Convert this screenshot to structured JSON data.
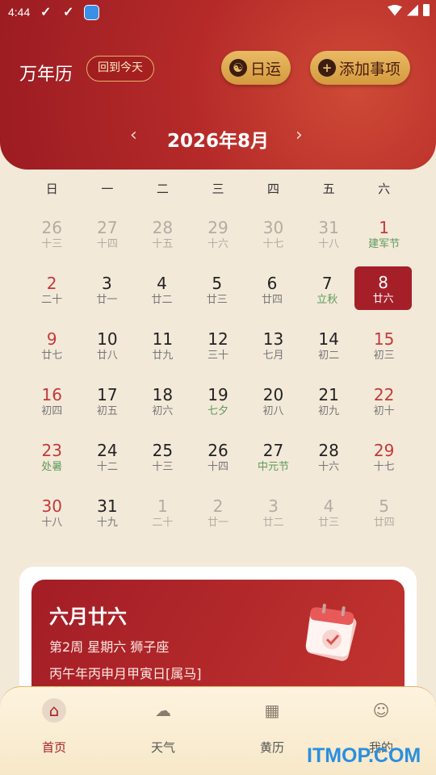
{
  "status": {
    "time": "4:44"
  },
  "header": {
    "title": "万年历",
    "today_label": "回到今天",
    "fortune_label": "日运",
    "add_label": "添加事项",
    "month": "2026年8月",
    "prev": "‹",
    "next": "›"
  },
  "weekdays": [
    "日",
    "一",
    "二",
    "三",
    "四",
    "五",
    "六"
  ],
  "weeks": [
    [
      {
        "d": "26",
        "l": "十三"
      },
      {
        "d": "27",
        "l": "十四"
      },
      {
        "d": "28",
        "l": "十五"
      },
      {
        "d": "29",
        "l": "十六"
      },
      {
        "d": "30",
        "l": "十七"
      },
      {
        "d": "31",
        "l": "十八"
      },
      {
        "d": "1",
        "l": "建军节"
      }
    ],
    [
      {
        "d": "2",
        "l": "二十"
      },
      {
        "d": "3",
        "l": "廿一"
      },
      {
        "d": "4",
        "l": "廿二"
      },
      {
        "d": "5",
        "l": "廿三"
      },
      {
        "d": "6",
        "l": "廿四"
      },
      {
        "d": "7",
        "l": "立秋"
      },
      {
        "d": "8",
        "l": "廿六"
      }
    ],
    [
      {
        "d": "9",
        "l": "廿七"
      },
      {
        "d": "10",
        "l": "廿八"
      },
      {
        "d": "11",
        "l": "廿九"
      },
      {
        "d": "12",
        "l": "三十"
      },
      {
        "d": "13",
        "l": "七月"
      },
      {
        "d": "14",
        "l": "初二"
      },
      {
        "d": "15",
        "l": "初三"
      }
    ],
    [
      {
        "d": "16",
        "l": "初四"
      },
      {
        "d": "17",
        "l": "初五"
      },
      {
        "d": "18",
        "l": "初六"
      },
      {
        "d": "19",
        "l": "七夕"
      },
      {
        "d": "20",
        "l": "初八"
      },
      {
        "d": "21",
        "l": "初九"
      },
      {
        "d": "22",
        "l": "初十"
      }
    ],
    [
      {
        "d": "23",
        "l": "处暑"
      },
      {
        "d": "24",
        "l": "十二"
      },
      {
        "d": "25",
        "l": "十三"
      },
      {
        "d": "26",
        "l": "十四"
      },
      {
        "d": "27",
        "l": "中元节"
      },
      {
        "d": "28",
        "l": "十六"
      },
      {
        "d": "29",
        "l": "十七"
      }
    ],
    [
      {
        "d": "30",
        "l": "十八"
      },
      {
        "d": "31",
        "l": "十九"
      },
      {
        "d": "1",
        "l": "二十"
      },
      {
        "d": "2",
        "l": "廿一"
      },
      {
        "d": "3",
        "l": "廿二"
      },
      {
        "d": "4",
        "l": "廿三"
      },
      {
        "d": "5",
        "l": "廿四"
      }
    ]
  ],
  "card": {
    "lunar_date": "六月廿六",
    "week_info": "第2周  星期六  狮子座",
    "ganzhi": "丙午年丙申月甲寅日[属马]"
  },
  "tabs": [
    {
      "label": "首页",
      "icon": "home-icon"
    },
    {
      "label": "天气",
      "icon": "weather-icon"
    },
    {
      "label": "黄历",
      "icon": "almanac-icon"
    },
    {
      "label": "我的",
      "icon": "profile-icon"
    }
  ],
  "watermark": "ITMOP.COM"
}
